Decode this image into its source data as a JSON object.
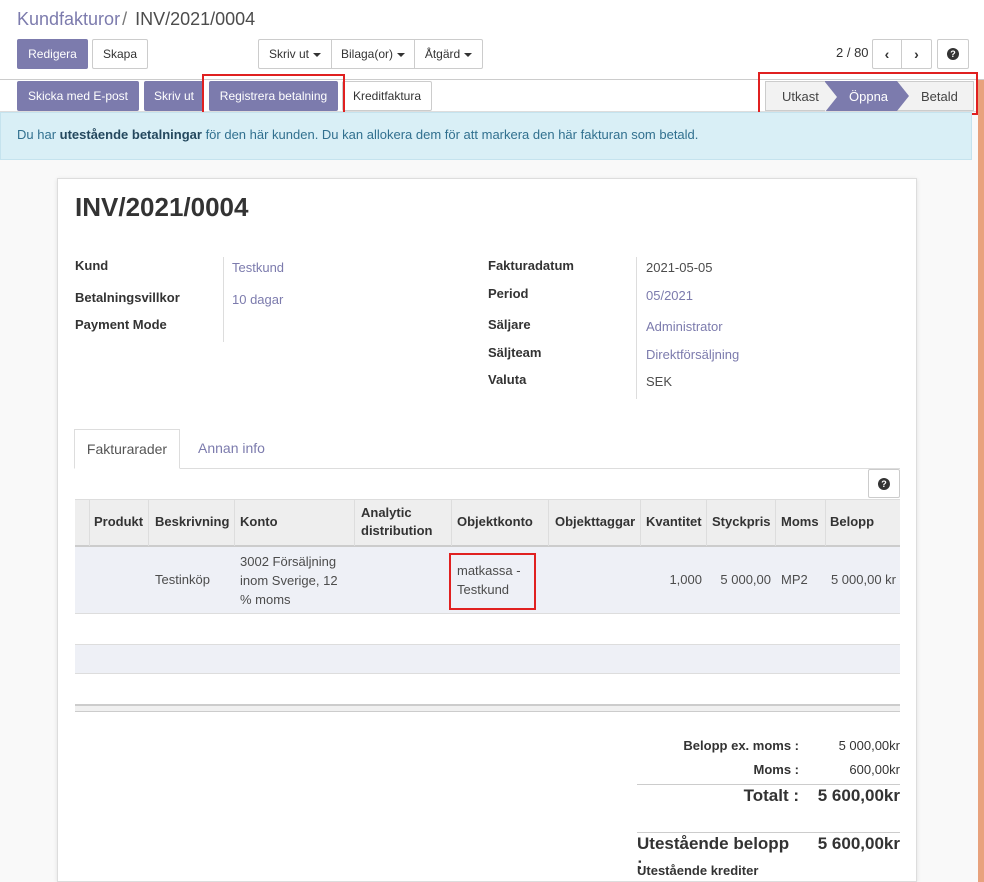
{
  "breadcrumb": {
    "parent": "Kundfakturor",
    "separator": "/",
    "current": "INV/2021/0004"
  },
  "toolbar": {
    "edit_label": "Redigera",
    "create_label": "Skapa",
    "print_label": "Skriv ut",
    "attachments_label": "Bilaga(or)",
    "action_label": "Åtgärd"
  },
  "pager": {
    "value": "2 / 80"
  },
  "header_buttons": {
    "send_email": "Skicka med E-post",
    "print": "Skriv ut",
    "register_payment": "Registrera betalning",
    "credit_note": "Kreditfaktura"
  },
  "status": {
    "steps": [
      "Utkast",
      "Öppna",
      "Betald"
    ],
    "active": "Öppna"
  },
  "alert": {
    "prefix": "Du har ",
    "bold": "utestående betalningar",
    "suffix": " för den här kunden. Du kan allokera dem för att markera den här fakturan som betald."
  },
  "invoice": {
    "title": "INV/2021/0004",
    "left_fields": [
      {
        "label": "Kund",
        "value": "Testkund"
      },
      {
        "label": "Betalningsvillkor",
        "value": "10 dagar"
      },
      {
        "label": "Payment Mode",
        "value": ""
      }
    ],
    "right_fields": [
      {
        "label": "Fakturadatum",
        "value": "2021-05-05"
      },
      {
        "label": "Period",
        "value": "05/2021"
      },
      {
        "label": "Säljare",
        "value": "Administrator"
      },
      {
        "label": "Säljteam",
        "value": "Direktförsäljning"
      },
      {
        "label": "Valuta",
        "value": "SEK"
      }
    ]
  },
  "tabs": [
    "Fakturarader",
    "Annan info"
  ],
  "table": {
    "headers": [
      "Produkt",
      "Beskrivning",
      "Konto",
      "Analytic distribution",
      "Objektkonto",
      "Objekttaggar",
      "Kvantitet",
      "Styckpris",
      "Moms",
      "Belopp"
    ],
    "rows": [
      {
        "produkt": "",
        "beskrivning": "Testinköp",
        "konto": [
          "3002 Försäljning",
          "inom Sverige, 12",
          "% moms"
        ],
        "analytic": "",
        "objektkonto": [
          "matkassa -",
          "Testkund"
        ],
        "objekttaggar": "",
        "kvantitet": "1,000",
        "styckpris": "5 000,00",
        "moms": "MP2",
        "belopp": "5 000,00 kr"
      }
    ]
  },
  "totals": {
    "ex_moms_label": "Belopp ex. moms :",
    "ex_moms_value": "5 000,00kr",
    "moms_label": "Moms :",
    "moms_value": "600,00kr",
    "total_label": "Totalt :",
    "total_value": "5 600,00kr",
    "outstanding_label": "Utestående belopp :",
    "outstanding_value": "5 600,00kr",
    "credits_label": "Utestående krediter"
  },
  "colors": {
    "brand": "#7c7bad",
    "highlight": "#e02020",
    "alert_bg": "#d9eff6"
  }
}
